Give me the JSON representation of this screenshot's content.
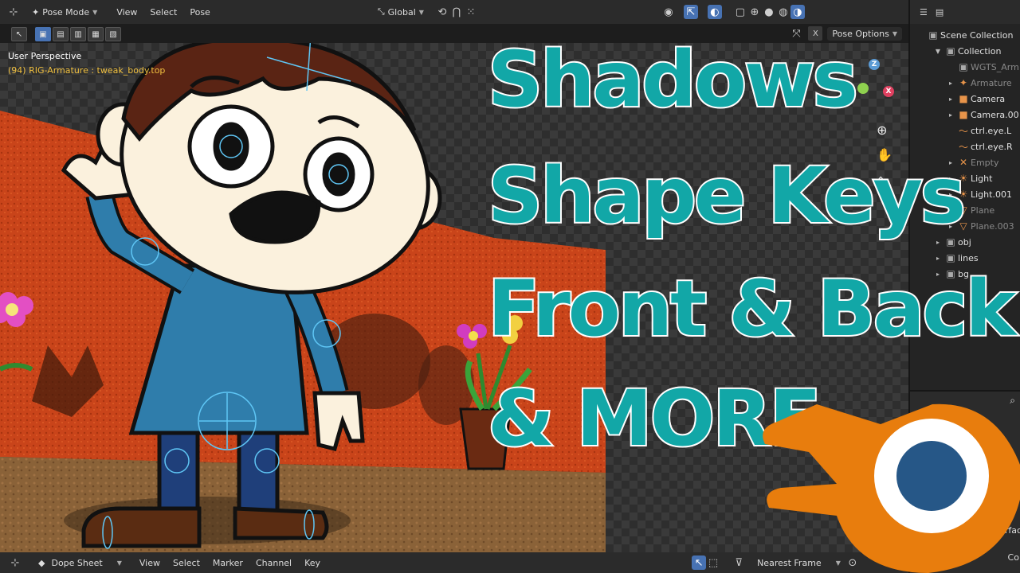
{
  "topbar": {
    "mode": "Pose Mode",
    "menus": [
      "View",
      "Select",
      "Pose"
    ],
    "transform_orientation": "Global"
  },
  "toolbar2": {
    "pose_options": "Pose Options"
  },
  "viewport": {
    "perspective": "User Perspective",
    "active_object": "(94) RIG-Armature : tweak_body.top",
    "gizmo": {
      "z": "Z",
      "x": "X"
    }
  },
  "headline": {
    "line1": "Shadows",
    "line2": "Shape Keys",
    "line3": "Front & Back",
    "line4": "& MORE"
  },
  "bottombar": {
    "editor": "Dope Sheet",
    "menus": [
      "View",
      "Select",
      "Marker",
      "Channel",
      "Key"
    ],
    "snap": "Nearest Frame"
  },
  "outliner": {
    "scene_collection": "Scene Collection",
    "collection": "Collection",
    "items": [
      "WGTS_Arm",
      "Armature",
      "Camera",
      "Camera.00",
      "ctrl.eye.L",
      "ctrl.eye.R",
      "Empty",
      "Light",
      "Light.001",
      "Plane",
      "Plane.003",
      "obj",
      "lines",
      "bg"
    ]
  },
  "properties": {
    "label1": "Surfac",
    "label2": "Col"
  },
  "colors": {
    "headline_fill": "#12a7a7",
    "headline_stroke": "#ffffff",
    "blender_orange": "#e87d0d",
    "blender_blue": "#265787",
    "wall_orange": "#c9441a",
    "accent_blue": "#4772b3"
  }
}
